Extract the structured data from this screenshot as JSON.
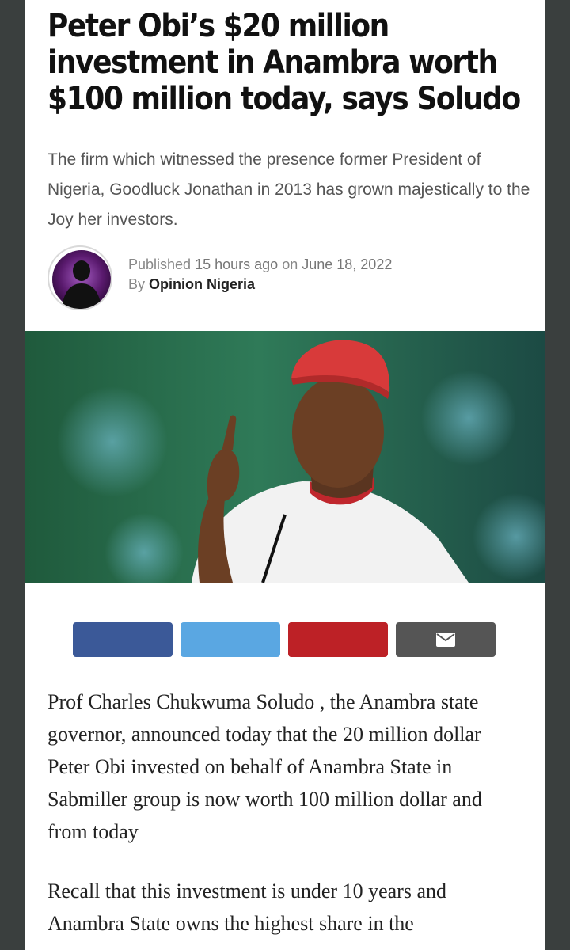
{
  "article": {
    "headline": "Peter Obi’s $20 million investment in Anambra worth $100 million today, says Soludo",
    "subheadline": "The firm which witnessed the presence former President of Nigeria, Goodluck Jonathan in 2013 has grown majestically to the Joy her investors.",
    "meta": {
      "published_prefix": "Published",
      "time_ago": "15 hours ago",
      "on": "on",
      "date": "June 18, 2022",
      "by": "By",
      "author": "Opinion Nigeria"
    },
    "paragraphs": [
      "Prof Charles Chukwuma Soludo , the Anambra state governor, announced today that the 20 million dollar Peter Obi invested on behalf of Anambra State in Sabmiller group is now worth 100 million dollar and from today",
      "Recall that this investment is under 10 years and Anambra State owns the highest share in the"
    ]
  },
  "share": {
    "buttons": [
      {
        "name": "facebook",
        "color": "#3b5998"
      },
      {
        "name": "twitter",
        "color": "#55acee"
      },
      {
        "name": "pinterest",
        "color": "#bd2126"
      },
      {
        "name": "email",
        "color": "#555555",
        "icon": "envelope-icon"
      }
    ]
  },
  "colors": {
    "background": "#3a3f3e",
    "avatar_purple": "#5a1a6e"
  }
}
